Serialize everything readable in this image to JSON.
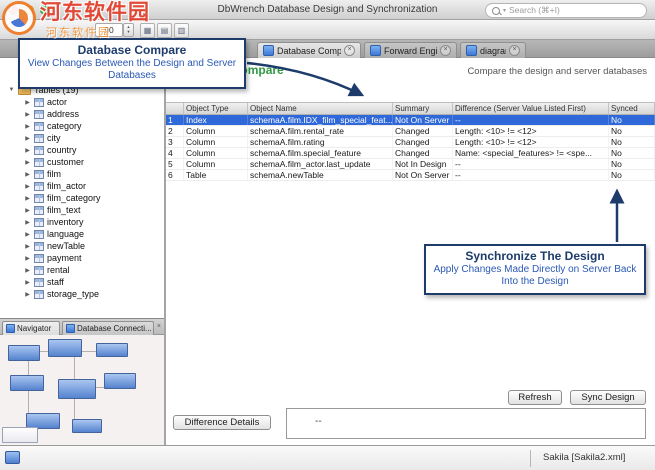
{
  "watermark": {
    "line1": "河东软件园",
    "line2": "河东软件园"
  },
  "titlebar": {
    "title": "DbWrench Database Design and Synchronization",
    "search_placeholder": "Search (⌘+I)"
  },
  "toolbar": {
    "zoom_value": "90"
  },
  "tabs": [
    {
      "label": "Database Compare"
    },
    {
      "label": "Forward Engineer"
    },
    {
      "label": "diagramA"
    }
  ],
  "panel": {
    "title": "Database Compare",
    "description": "Compare the design and server databases"
  },
  "callouts": {
    "compare": {
      "title": "Database Compare",
      "body": "View Changes Between the Design and Server Databases"
    },
    "sync": {
      "title": "Synchronize The Design",
      "body": "Apply Changes Made Directly on Server Back Into the Design"
    }
  },
  "sidebar": {
    "root": "Tables (19)",
    "items": [
      "actor",
      "address",
      "category",
      "city",
      "country",
      "customer",
      "film",
      "film_actor",
      "film_category",
      "film_text",
      "inventory",
      "language",
      "newTable",
      "payment",
      "rental",
      "staff",
      "storage_type"
    ]
  },
  "navigator": {
    "tab1": "Navigator",
    "tab2": "Database Connecti..."
  },
  "table": {
    "headers": [
      "",
      "Object Type",
      "Object Name",
      "Summary",
      "Difference (Server Value Listed First)",
      "Synced"
    ],
    "rows": [
      [
        "1",
        "Index",
        "schemaA.film.IDX_film_special_feat...",
        "Not On Server",
        "--",
        "No"
      ],
      [
        "2",
        "Column",
        "schemaA.film.rental_rate",
        "Changed",
        "Length: <10> != <12>",
        "No"
      ],
      [
        "3",
        "Column",
        "schemaA.film.rating",
        "Changed",
        "Length: <10> != <12>",
        "No"
      ],
      [
        "4",
        "Column",
        "schemaA.film.special_feature",
        "Changed",
        "Name: <special_features> != <spe...",
        "No"
      ],
      [
        "5",
        "Column",
        "schemaA.film_actor.last_update",
        "Not In Design",
        "--",
        "No"
      ],
      [
        "6",
        "Table",
        "schemaA.newTable",
        "Not On Server",
        "--",
        "No"
      ]
    ]
  },
  "buttons": {
    "refresh": "Refresh",
    "sync_design": "Sync Design",
    "difference_details": "Difference Details"
  },
  "details": {
    "value": "--"
  },
  "statusbar": {
    "database": "Sakila [Sakila2.xml]"
  },
  "icons": {
    "close": "×",
    "tri_right": "▶",
    "tri_down": "▼",
    "chevron_down": "▾",
    "stepper": "▴▾"
  },
  "colors": {
    "selection": "#2f68d8",
    "callout_border": "#1d3c6b",
    "title_green": "#2f9a45",
    "watermark_red": "#e23c28"
  }
}
